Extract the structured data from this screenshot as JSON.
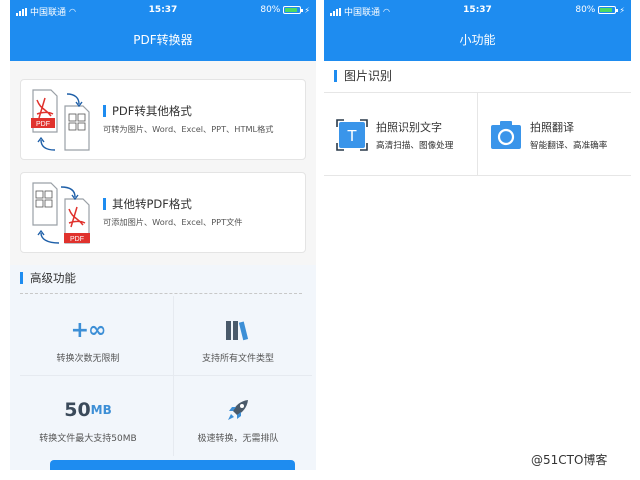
{
  "left": {
    "status": {
      "carrier": "中国联通",
      "time": "15:37",
      "battery": "80%",
      "battery_level": 0.8
    },
    "title": "PDF转换器",
    "cards": [
      {
        "title": "PDF转其他格式",
        "subtitle": "可转为图片、Word、Excel、PPT、HTML格式",
        "badge": "PDF",
        "icon": "pdf-to-other-icon"
      },
      {
        "title": "其他转PDF格式",
        "subtitle": "可添加图片、Word、Excel、PPT文件",
        "badge": "PDF",
        "icon": "other-to-pdf-icon"
      }
    ],
    "advanced": {
      "heading": "高级功能",
      "features": [
        {
          "icon_text": "+∞",
          "label": "转换次数无限制",
          "icon": "infinity-icon"
        },
        {
          "label": "支持所有文件类型",
          "icon": "books-icon"
        },
        {
          "icon_num": "50",
          "icon_unit": "MB",
          "label": "转换文件最大支持50MB",
          "icon": "file-size-icon"
        },
        {
          "label": "极速转换，无需排队",
          "icon": "rocket-icon"
        }
      ]
    }
  },
  "right": {
    "status": {
      "carrier": "中国联通",
      "time": "15:37",
      "battery": "80%",
      "battery_level": 0.8
    },
    "title": "小功能",
    "section": "图片识别",
    "items": [
      {
        "name": "拍照识别文字",
        "desc": "高清扫描、图像处理",
        "glyph": "T",
        "icon": "text-scan-icon"
      },
      {
        "name": "拍照翻译",
        "desc": "智能翻译、高准确率",
        "icon": "camera-icon"
      }
    ]
  },
  "watermark": "@51CTO博客",
  "colors": {
    "primary": "#1e8cf0",
    "pdf_red": "#e0322d",
    "battery": "#4cd964"
  }
}
